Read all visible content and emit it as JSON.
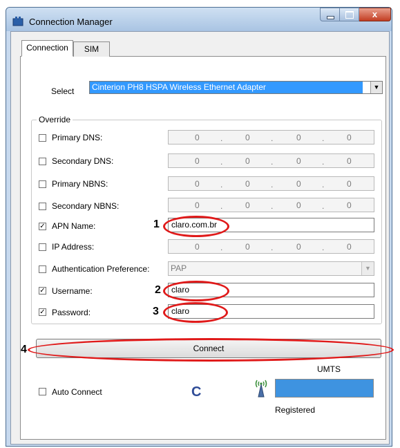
{
  "window": {
    "title": "Connection Manager",
    "close_glyph": "x"
  },
  "tabs": [
    {
      "label": "Connection"
    },
    {
      "label": "SIM"
    }
  ],
  "select": {
    "label": "Select",
    "value": "Cinterion PH8 HSPA Wireless Ethernet Adapter"
  },
  "override": {
    "legend": "Override",
    "primary_dns": {
      "label": "Primary DNS:",
      "checked": false,
      "octets": [
        "0",
        "0",
        "0",
        "0"
      ]
    },
    "secondary_dns": {
      "label": "Secondary DNS:",
      "checked": false,
      "octets": [
        "0",
        "0",
        "0",
        "0"
      ]
    },
    "primary_nbns": {
      "label": "Primary NBNS:",
      "checked": false,
      "octets": [
        "0",
        "0",
        "0",
        "0"
      ]
    },
    "secondary_nbns": {
      "label": "Secondary NBNS:",
      "checked": false,
      "octets": [
        "0",
        "0",
        "0",
        "0"
      ]
    },
    "apn_name": {
      "label": "APN Name:",
      "checked": true,
      "value": "claro.com.br"
    },
    "ip_address": {
      "label": "IP Address:",
      "checked": false,
      "octets": [
        "0",
        "0",
        "0",
        "0"
      ]
    },
    "auth_pref": {
      "label": "Authentication Preference:",
      "checked": false,
      "value": "PAP"
    },
    "username": {
      "label": "Username:",
      "checked": true,
      "value": "claro"
    },
    "password": {
      "label": "Password:",
      "checked": true,
      "value": "claro"
    }
  },
  "connect_button": {
    "label": "Connect"
  },
  "auto_connect": {
    "label": "Auto Connect",
    "checked": false
  },
  "status": {
    "network_type": "UMTS",
    "registration": "Registered",
    "refresh_glyph": "C",
    "signal_level": 1.0
  },
  "annotations": {
    "n1": "1",
    "n2": "2",
    "n3": "3",
    "n4": "4",
    "color": "#e01a1a"
  },
  "icons": {
    "app": "network-app-icon",
    "antenna": "antenna-icon"
  }
}
